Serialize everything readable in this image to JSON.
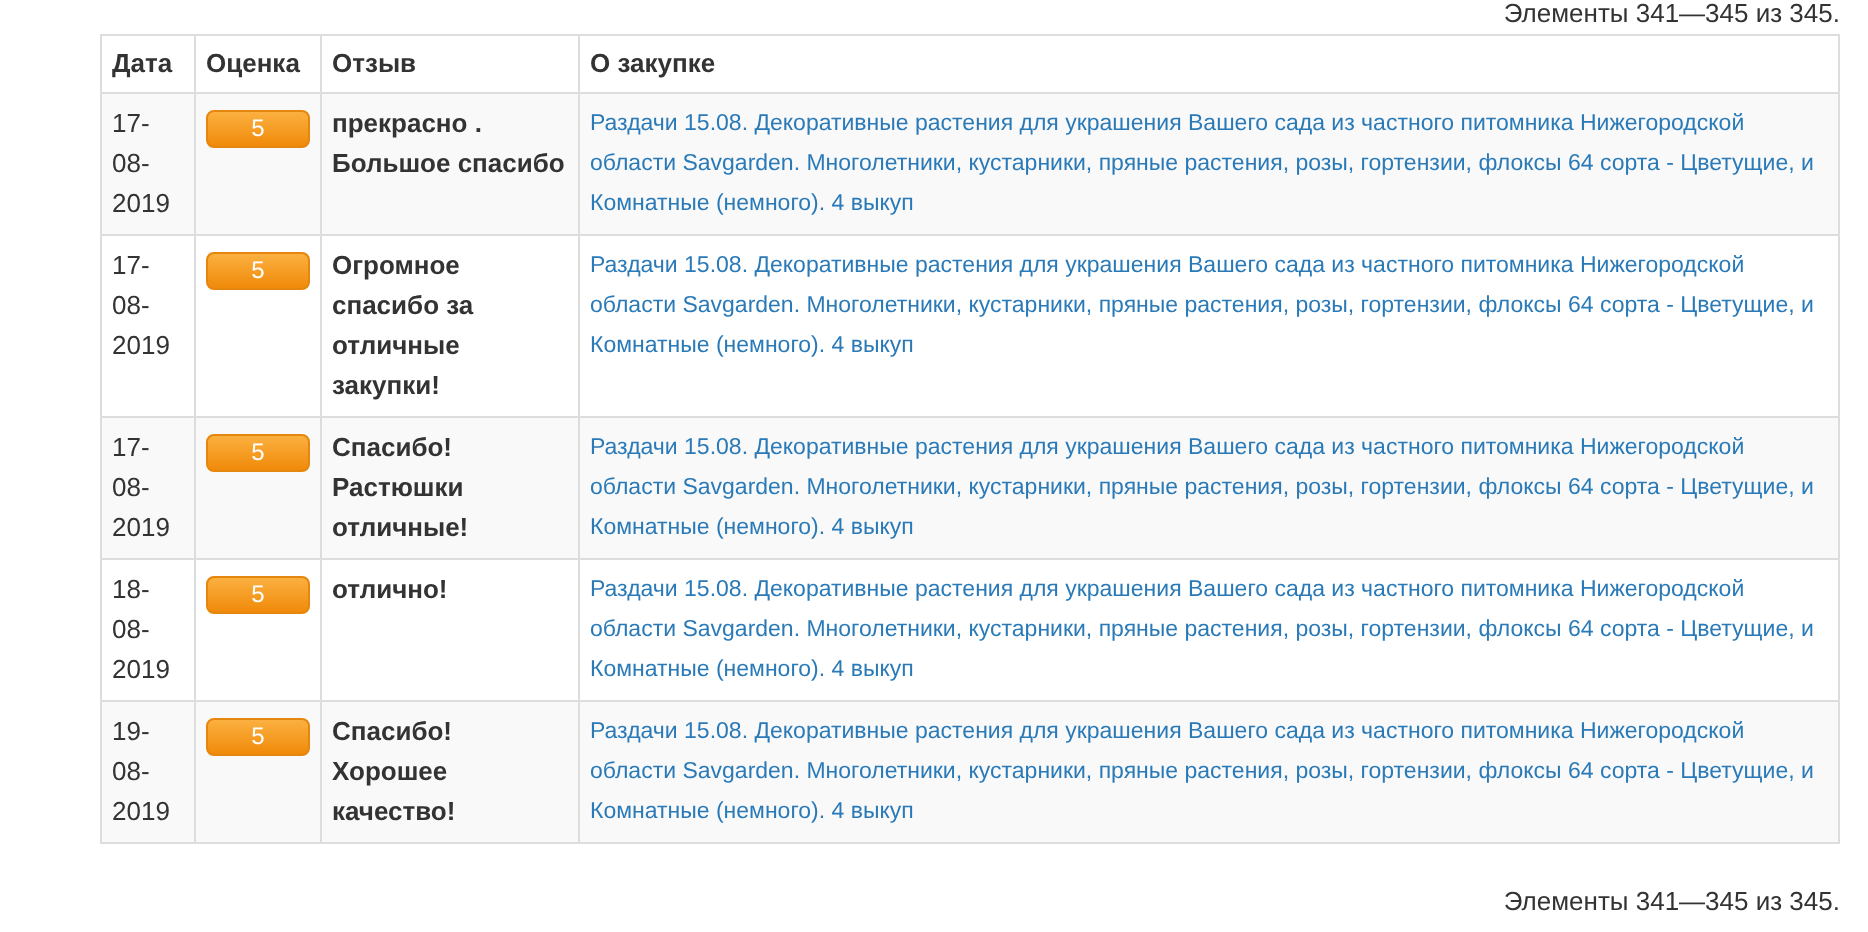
{
  "summary_top": "Элементы 341—345 из 345.",
  "table": {
    "columns": [
      "Дата",
      "Оценка",
      "Отзыв",
      "О закупке"
    ],
    "rows": [
      {
        "date": "17-08-2019",
        "rating": "5",
        "review": "прекрасно . Большое спасибо",
        "purchase": "Раздачи 15.08. Декоративные растения для украшения Вашего сада из частного питомника Нижегородской области Savgarden. Многолетники, кустарники, пряные растения, розы, гортензии, флоксы 64 сорта - Цветущие, и Комнатные (немного). 4 выкуп"
      },
      {
        "date": "17-08-2019",
        "rating": "5",
        "review": "Огромное спасибо за отличные закупки!",
        "purchase": "Раздачи 15.08. Декоративные растения для украшения Вашего сада из частного питомника Нижегородской области Savgarden. Многолетники, кустарники, пряные растения, розы, гортензии, флоксы 64 сорта - Цветущие, и Комнатные (немного). 4 выкуп"
      },
      {
        "date": "17-08-2019",
        "rating": "5",
        "review": "Спасибо! Растюшки отличные!",
        "purchase": "Раздачи 15.08. Декоративные растения для украшения Вашего сада из частного питомника Нижегородской области Savgarden. Многолетники, кустарники, пряные растения, розы, гортензии, флоксы 64 сорта - Цветущие, и Комнатные (немного). 4 выкуп"
      },
      {
        "date": "18-08-2019",
        "rating": "5",
        "review": "отлично!",
        "purchase": "Раздачи 15.08. Декоративные растения для украшения Вашего сада из частного питомника Нижегородской области Savgarden. Многолетники, кустарники, пряные растения, розы, гортензии, флоксы 64 сорта - Цветущие, и Комнатные (немного). 4 выкуп"
      },
      {
        "date": "19-08-2019",
        "rating": "5",
        "review": "Спасибо! Хорошее качество!",
        "purchase": "Раздачи 15.08. Декоративные растения для украшения Вашего сада из частного питомника Нижегородской области Savgarden. Многолетники, кустарники, пряные растения, розы, гортензии, флоксы 64 сорта - Цветущие, и Комнатные (немного). 4 выкуп"
      }
    ]
  },
  "summary_bottom": "Элементы 341—345 из 345."
}
